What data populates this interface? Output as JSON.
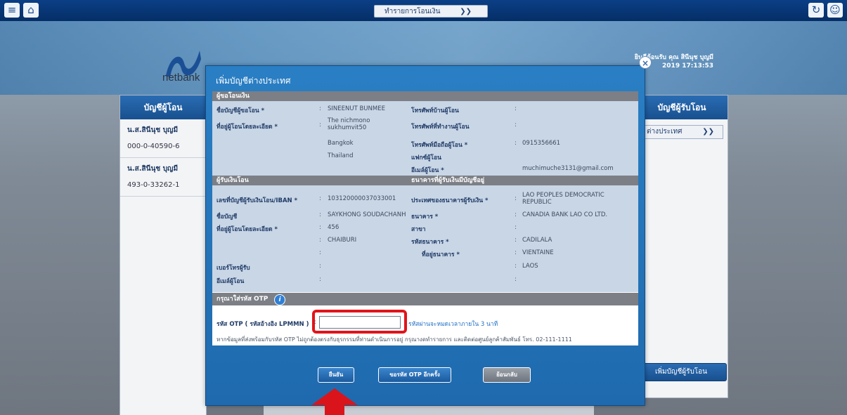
{
  "topbar": {
    "dropdown_label": "ทำรายการโอนเงิน",
    "menu_icon": "hamburger-icon",
    "home_icon": "home-icon"
  },
  "branding": {
    "logo_text": "netbank"
  },
  "greeting": {
    "line1": "ยินดีต้อนรับ คุณ สินีนุช บุญมี",
    "line2": "2019 17:13:53"
  },
  "left_panel": {
    "title": "บัญชีผู้โอน",
    "accounts": [
      {
        "name": "น.ส.สินีนุช บุญมี",
        "number": "000-0-40590-6"
      },
      {
        "name": "น.ส.สินีนุช บุญมี",
        "number": "493-0-33262-1"
      }
    ]
  },
  "right_panel": {
    "title": "บัญชีผู้รับโอน",
    "select_value": "ต่างประเทศ",
    "add_button": "เพิ่มบัญชีผู้รับโอน"
  },
  "modal": {
    "title": "เพิ่มบัญชีต่างประเทศ",
    "sender_section": "ผู้ขอโอนเงิน",
    "sender": {
      "account_name_label": "ชื่อบัญชีผู้ขอโอน *",
      "account_name": "SINEENUT BUNMEE",
      "address_label": "ที่อยู่ผู้โอนโดยละเอียด *",
      "address_lines": [
        "The nichmono",
        "sukhumvit50",
        "Bangkok",
        "Thailand"
      ],
      "home_phone_label": "โทรศัพท์บ้านผู้โอน",
      "work_phone_label": "โทรศัพท์ที่ทำงานผู้โอน",
      "mobile_label": "โทรศัพท์มือถือผู้โอน *",
      "mobile": "0915356661",
      "fax_label": "แฟกซ์ผู้โอน",
      "email_label": "อีเมล์ผู้โอน *",
      "email": "muchimuche3131@gmail.com"
    },
    "recipient_section": "ผู้รับเงินโอน",
    "bank_section": "ธนาคารที่ผู้รับเงินมีบัญชีอยู่",
    "recipient": {
      "account_label": "เลขที่บัญชีผู้รับเงินโอน/IBAN *",
      "account": "103120000037033001",
      "name_label": "ชื่อบัญชี",
      "name": "SAYKHONG SOUDACHANH",
      "address_label": "ที่อยู่ผู้โอนโดยละเอียด *",
      "address_lines": [
        "456",
        "CHAIBURI"
      ],
      "phone_label": "เบอร์โทรผู้รับ",
      "email_label": "อีเมล์ผู้โอน"
    },
    "bank": {
      "country_label": "ประเทศของธนาคารผู้รับเงิน *",
      "country_line1": "LAO PEOPLES DEMOCRATIC",
      "country_line2": "REPUBLIC",
      "bank_label": "ธนาคาร *",
      "bank": "CANADIA BANK LAO CO LTD.",
      "branch_label": "สาขา",
      "swift_label": "รหัสธนาคาร *",
      "swift": "CADILALA",
      "address_label": "ที่อยู่ธนาคาร *",
      "address_line1": "VIENTAINE",
      "address_line2": "LAOS"
    },
    "otp_section": "กรุณาใส่รหัส OTP",
    "otp_label": "รหัส OTP ( รหัสอ้างอิง LPMMN )",
    "otp_value": "",
    "otp_note": "รหัสผ่านจะหมดเวลาภายใน 3 นาที",
    "otp_help": "หากข้อมูลที่ส่งพร้อมกับรหัส OTP ไม่ถูกต้องตรงกับธุรกรรมที่ท่านดำเนินการอยู่ กรุณางดทำรายการ และติดต่อศูนย์ลูกค้าสัมพันธ์ โทร. 02-111-1111",
    "buttons": {
      "confirm": "ยืนยัน",
      "resend": "ขอรหัส OTP อีกครั้ง",
      "back": "ย้อนกลับ"
    }
  },
  "colors": {
    "highlight": "#e1141b",
    "modal": "#2277bb",
    "section": "#7c7f85",
    "field_bg": "#c8d6e6"
  }
}
